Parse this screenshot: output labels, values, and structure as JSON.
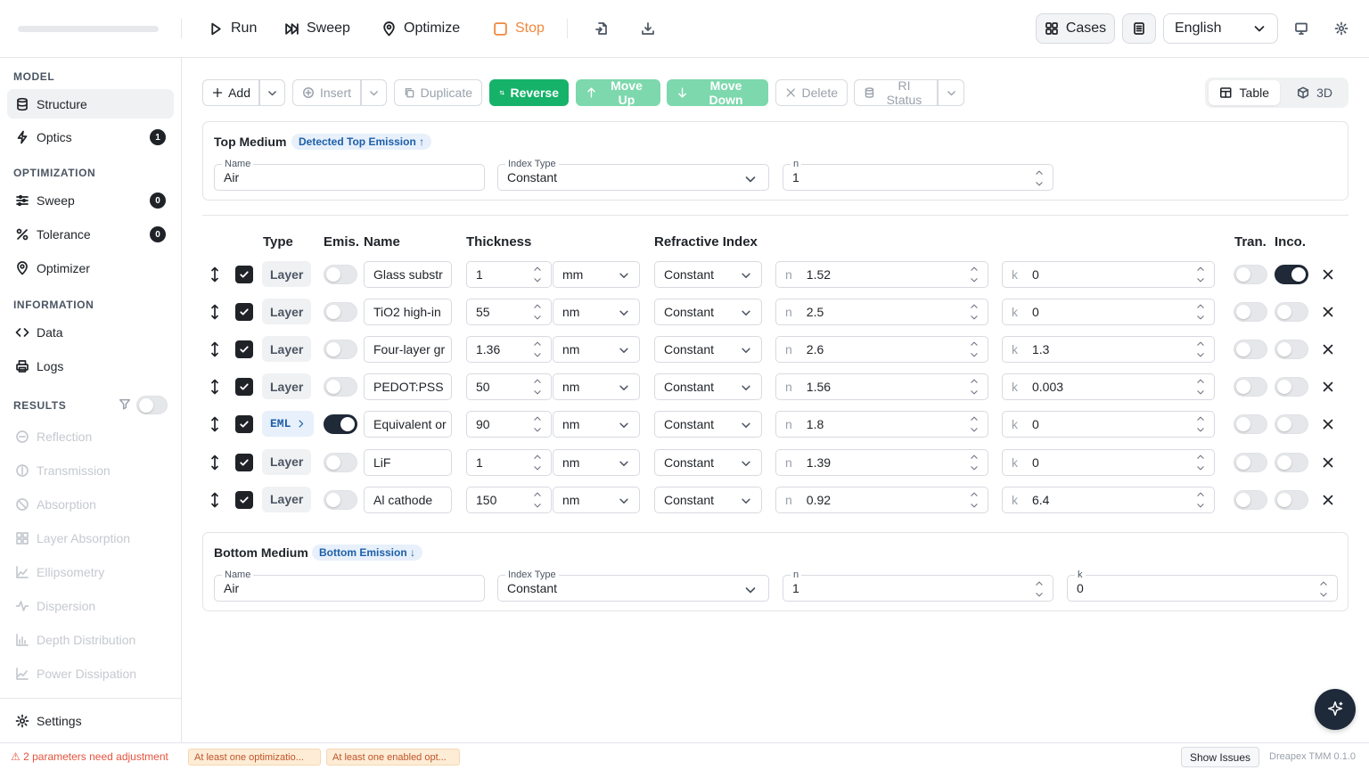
{
  "toolbar": {
    "progress": 0,
    "run": "Run",
    "sweep": "Sweep",
    "optimize": "Optimize",
    "stop": "Stop",
    "stop_color": "#f0883e",
    "cases": "Cases",
    "language": "English"
  },
  "sidebar": {
    "model_head": "MODEL",
    "structure": "Structure",
    "optics": "Optics",
    "optics_badge": "1",
    "optimization_head": "OPTIMIZATION",
    "sweep": "Sweep",
    "sweep_badge": "0",
    "tolerance": "Tolerance",
    "tolerance_badge": "0",
    "optimizer": "Optimizer",
    "information_head": "INFORMATION",
    "data": "Data",
    "logs": "Logs",
    "results_head": "RESULTS",
    "results": [
      "Reflection",
      "Transmission",
      "Absorption",
      "Layer Absorption",
      "Ellipsometry",
      "Dispersion",
      "Depth Distribution",
      "Power Dissipation"
    ],
    "settings": "Settings"
  },
  "actions": {
    "add": "Add",
    "insert": "Insert",
    "duplicate": "Duplicate",
    "reverse": "Reverse",
    "move_up": "Move Up",
    "move_down": "Move Down",
    "delete": "Delete",
    "ri_status": "RI Status",
    "view_table": "Table",
    "view_3d": "3D"
  },
  "top_medium": {
    "title": "Top Medium",
    "badge": "Detected Top Emission ↑",
    "name_label": "Name",
    "name": "Air",
    "index_type_label": "Index Type",
    "index_type": "Constant",
    "n_label": "n",
    "n": "1"
  },
  "table": {
    "headers": {
      "type": "Type",
      "emis": "Emis.",
      "name": "Name",
      "thickness": "Thickness",
      "ri": "Refractive Index",
      "tran": "Tran.",
      "inco": "Inco."
    },
    "n_prefix": "n",
    "k_prefix": "k",
    "rows": [
      {
        "type": "Layer",
        "emis": false,
        "name": "Glass substr",
        "thickness": "1",
        "unit": "mm",
        "ri_type": "Constant",
        "n": "1.52",
        "k": "0",
        "tran": false,
        "inco": true
      },
      {
        "type": "Layer",
        "emis": false,
        "name": "TiO2 high-in",
        "thickness": "55",
        "unit": "nm",
        "ri_type": "Constant",
        "n": "2.5",
        "k": "0",
        "tran": false,
        "inco": false
      },
      {
        "type": "Layer",
        "emis": false,
        "name": "Four-layer gr",
        "thickness": "1.36",
        "unit": "nm",
        "ri_type": "Constant",
        "n": "2.6",
        "k": "1.3",
        "tran": false,
        "inco": false
      },
      {
        "type": "Layer",
        "emis": false,
        "name": "PEDOT:PSS",
        "thickness": "50",
        "unit": "nm",
        "ri_type": "Constant",
        "n": "1.56",
        "k": "0.003",
        "tran": false,
        "inco": false
      },
      {
        "type": "EML",
        "emis": true,
        "name": "Equivalent or",
        "thickness": "90",
        "unit": "nm",
        "ri_type": "Constant",
        "n": "1.8",
        "k": "0",
        "tran": false,
        "inco": false
      },
      {
        "type": "Layer",
        "emis": false,
        "name": "LiF",
        "thickness": "1",
        "unit": "nm",
        "ri_type": "Constant",
        "n": "1.39",
        "k": "0",
        "tran": false,
        "inco": false
      },
      {
        "type": "Layer",
        "emis": false,
        "name": "Al cathode",
        "thickness": "150",
        "unit": "nm",
        "ri_type": "Constant",
        "n": "0.92",
        "k": "6.4",
        "tran": false,
        "inco": false
      }
    ]
  },
  "bottom_medium": {
    "title": "Bottom Medium",
    "badge": "Bottom Emission ↓",
    "name_label": "Name",
    "name": "Air",
    "index_type_label": "Index Type",
    "index_type": "Constant",
    "n_label": "n",
    "n": "1",
    "k_label": "k",
    "k": "0"
  },
  "status": {
    "warning": "⚠ 2 parameters need adjustment",
    "chip1": "At least one optimizatio...",
    "chip2": "At least one enabled opt...",
    "show_issues": "Show Issues",
    "version": "Dreapex TMM 0.1.0"
  }
}
